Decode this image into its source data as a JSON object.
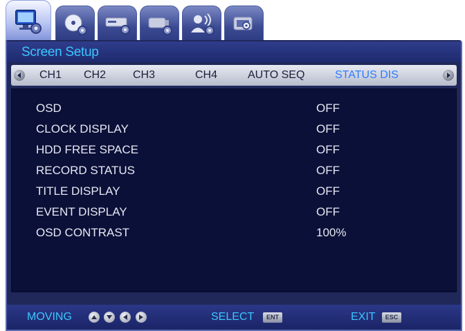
{
  "tabs": [
    {
      "icon": "monitor-settings-icon",
      "active": true
    },
    {
      "icon": "disc-settings-icon",
      "active": false
    },
    {
      "icon": "recorder-settings-icon",
      "active": false
    },
    {
      "icon": "camera-settings-icon",
      "active": false
    },
    {
      "icon": "user-network-icon",
      "active": false
    },
    {
      "icon": "system-settings-icon",
      "active": false
    }
  ],
  "panel": {
    "title": "Screen Setup"
  },
  "channel_tabs": [
    {
      "label": "CH1",
      "active": false
    },
    {
      "label": "CH2",
      "active": false
    },
    {
      "label": "CH3",
      "active": false
    },
    {
      "label": "CH4",
      "active": false
    },
    {
      "label": "AUTO SEQ",
      "active": false
    },
    {
      "label": "STATUS DIS",
      "active": true
    }
  ],
  "settings": [
    {
      "label": "OSD",
      "value": "OFF"
    },
    {
      "label": "CLOCK DISPLAY",
      "value": "OFF"
    },
    {
      "label": "HDD FREE SPACE",
      "value": "OFF"
    },
    {
      "label": "RECORD STATUS",
      "value": "OFF"
    },
    {
      "label": "TITLE DISPLAY",
      "value": "OFF"
    },
    {
      "label": "EVENT DISPLAY",
      "value": "OFF"
    },
    {
      "label": "OSD CONTRAST",
      "value": "100%"
    }
  ],
  "footer": {
    "moving_label": "MOVING",
    "select_label": "SELECT",
    "select_key": "ENT",
    "exit_label": "EXIT",
    "exit_key": "ESC"
  },
  "colors": {
    "accent": "#3cc6ff",
    "active_tab_text": "#2f7cff",
    "panel_bg": "#20285a",
    "content_bg": "#0b1038"
  }
}
